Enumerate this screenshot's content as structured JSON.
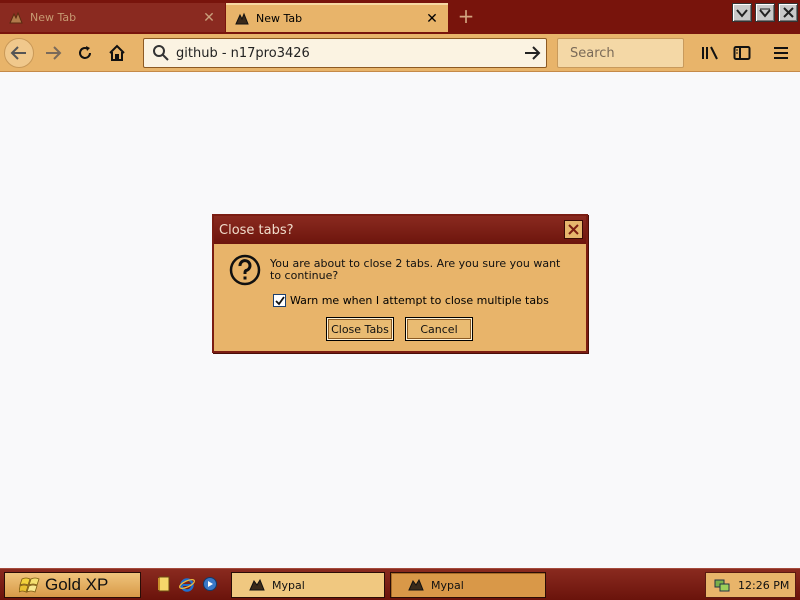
{
  "browser": {
    "tabs": [
      {
        "label": "New Tab",
        "active": false
      },
      {
        "label": "New Tab",
        "active": true
      }
    ],
    "new_tab_glyph": "+",
    "url_value": "github - n17pro3426",
    "search_placeholder": "Search",
    "icons": [
      "back-arrow-icon",
      "forward-arrow-icon",
      "reload-icon",
      "home-icon",
      "search-icon",
      "go-arrow-icon",
      "library-icon",
      "sidebar-icon",
      "menu-icon"
    ]
  },
  "dialog": {
    "title": "Close tabs?",
    "message": "You are about to close 2 tabs. Are you sure you want to continue?",
    "checkbox_label": "Warn me when I attempt to close multiple tabs",
    "checkbox_checked": true,
    "close_button": "Close Tabs",
    "cancel_button": "Cancel"
  },
  "taskbar": {
    "start_label": "Gold XP",
    "tasks": [
      {
        "label": "Mypal",
        "active": false
      },
      {
        "label": "Mypal",
        "active": true
      }
    ],
    "clock": "12:26 PM"
  },
  "colors": {
    "frame": "#78140c",
    "toolbar": "#e8b46a",
    "content": "#f9f9fa"
  }
}
